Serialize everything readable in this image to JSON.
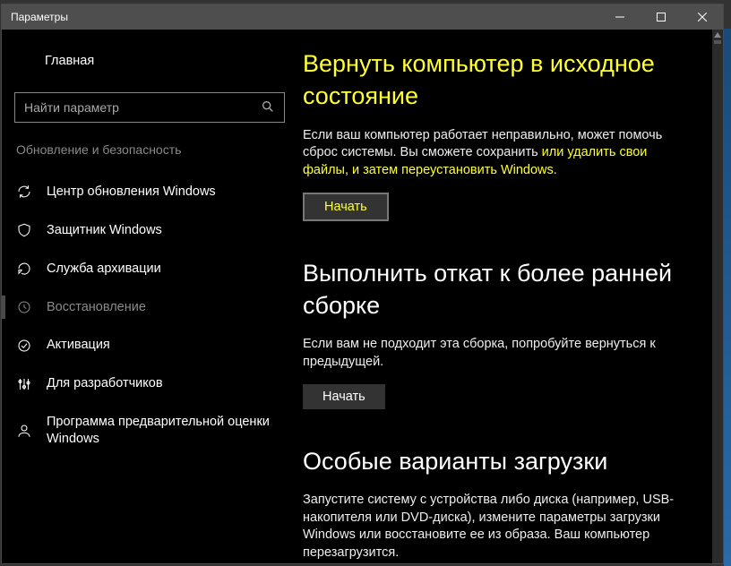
{
  "window": {
    "title": "Параметры"
  },
  "sidebar": {
    "home": "Главная",
    "search_placeholder": "Найти параметр",
    "section": "Обновление и безопасность",
    "items": [
      {
        "label": "Центр обновления Windows"
      },
      {
        "label": "Защитник Windows"
      },
      {
        "label": "Служба архивации"
      },
      {
        "label": "Восстановление"
      },
      {
        "label": "Активация"
      },
      {
        "label": "Для разработчиков"
      },
      {
        "label": "Программа предварительной оценки Windows"
      }
    ]
  },
  "sections": {
    "reset": {
      "title": "Вернуть компьютер в исходное состояние",
      "text_a": "Если ваш компьютер работает неправильно, может помочь сброс системы. Вы сможете сохранить ",
      "text_accent": "или удалить свои файлы, и затем переустановить Windows",
      "text_b": ".",
      "button": "Начать"
    },
    "rollback": {
      "title": "Выполнить откат к более ранней сборке",
      "text": "Если вам не подходит эта сборка, попробуйте вернуться к предыдущей.",
      "button": "Начать"
    },
    "advanced": {
      "title": "Особые варианты загрузки",
      "text": "Запустите систему с устройства либо диска (например, USB-накопителя или DVD-диска), измените параметры загрузки Windows или восстановите ее из образа. Ваш компьютер перезагрузится."
    }
  }
}
